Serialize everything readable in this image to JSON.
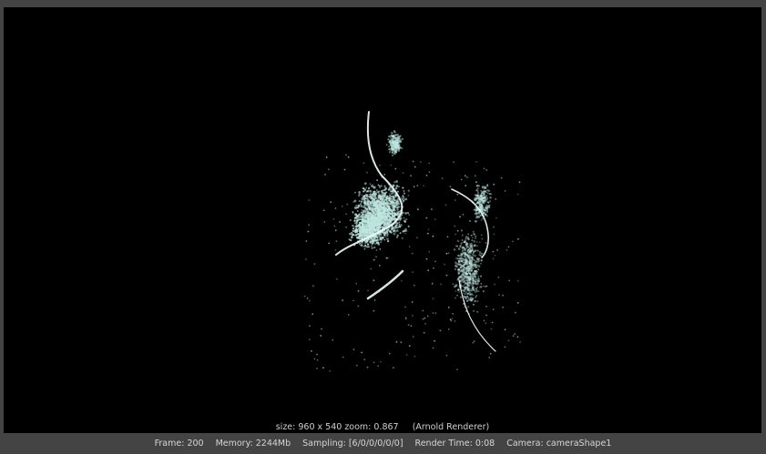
{
  "viewport": {
    "size_text": "size: 960 x 540 zoom: 0.867",
    "renderer_text": "(Arnold Renderer)",
    "particle_color": "#bfe6e0"
  },
  "status": {
    "frame": "Frame: 200",
    "memory": "Memory: 2244Mb",
    "sampling": "Sampling: [6/0/0/0/0/0]",
    "render_time": "Render Time: 0:08",
    "camera": "Camera: cameraShape1"
  }
}
